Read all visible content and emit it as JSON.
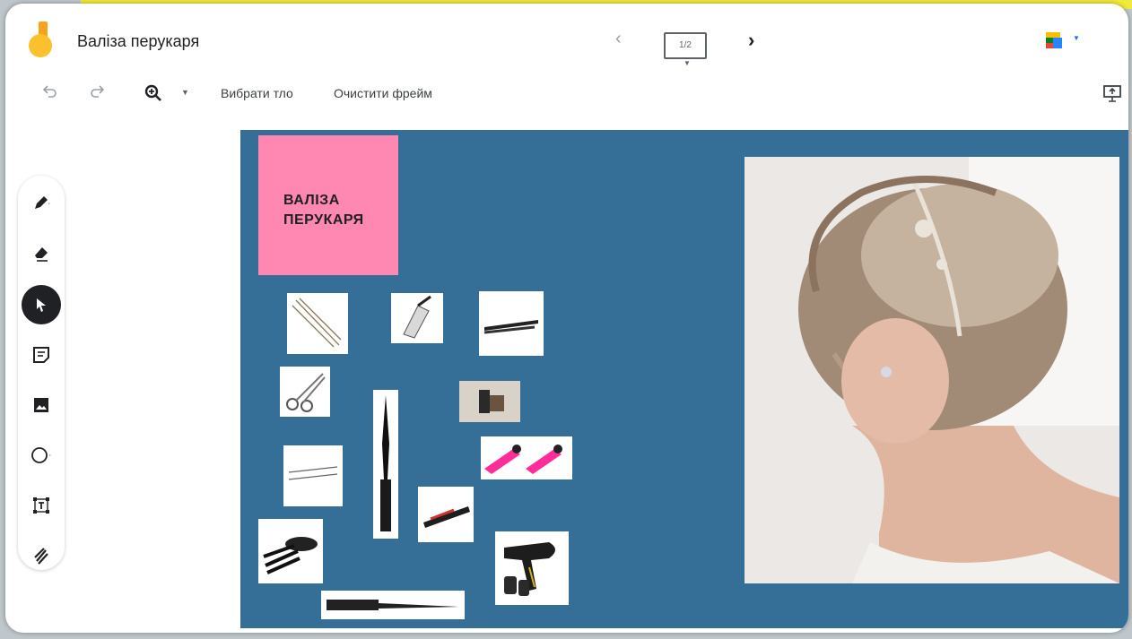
{
  "header": {
    "title": "Валіза перукаря",
    "frame_counter": "1/2",
    "prev_glyph": "‹",
    "next_glyph": "›"
  },
  "toolbar": {
    "background_label": "Вибрати тло",
    "clear_label": "Очистити фрейм"
  },
  "sidebar": {
    "tools": [
      "pen",
      "eraser",
      "select",
      "sticky-note",
      "image",
      "shape",
      "text-box",
      "laser"
    ],
    "active_tool": "select"
  },
  "canvas": {
    "background_color": "#356f97",
    "sticky_color": "#ff88b3",
    "sticky_text": "ВАЛІЗА ПЕРУКАРЯ",
    "images": [
      "hairpins-image",
      "hair-clipper-image",
      "flat-iron-image",
      "scissors-image",
      "hair-roller-image",
      "round-brush-image",
      "pink-clips-image",
      "bobby-pins-image",
      "mini-straightener-image",
      "dye-brushes-bowl-image",
      "tail-comb-image",
      "hair-dryer-image",
      "bridal-updo-photo"
    ]
  },
  "colors": {
    "accent_yellow": "#f0ea3a",
    "logo_orange": "#f8a31d",
    "logo_yellow": "#fbc02d"
  }
}
